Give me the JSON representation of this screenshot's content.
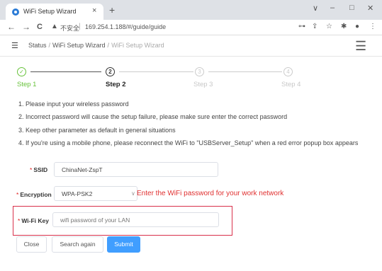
{
  "browser": {
    "tab_title": "WiFi Setup Wizard",
    "tab_close": "×",
    "new_tab": "+",
    "window_controls": [
      "∨",
      "–",
      "□",
      "✕"
    ],
    "nav": {
      "back": "←",
      "forward": "→",
      "reload": "C"
    },
    "security_label": "不安全",
    "url": "169.254.1.188/#/guide/guide"
  },
  "header": {
    "breadcrumbs": [
      "Status",
      "WiFi Setup Wizard",
      "WiFi Setup Wizard"
    ]
  },
  "steps": [
    {
      "label": "Step 1",
      "state": "done",
      "symbol": "✓"
    },
    {
      "label": "Step 2",
      "state": "current",
      "symbol": "2"
    },
    {
      "label": "Step 3",
      "state": "pending",
      "symbol": "3"
    },
    {
      "label": "Step 4",
      "state": "pending",
      "symbol": "4"
    }
  ],
  "instructions": [
    "1. Please input your wireless password",
    "2. Incorrect password will cause the setup failure, please make sure enter the correct password",
    "3. Keep other parameter as default in general situations",
    "4. If you're using a mobile phone, please reconnect the WiFi to \"USBServer_Setup\" when a red error popup box appears"
  ],
  "form": {
    "ssid": {
      "label": "SSID",
      "value": "ChinaNet-ZspT"
    },
    "encryption": {
      "label": "Encryption",
      "value": "WPA-PSK2"
    },
    "wifi_key": {
      "label": "Wi-Fi Key",
      "placeholder": "wifi password of your LAN"
    },
    "required_mark": "*"
  },
  "annotation": "Enter the WiFi password for your work network",
  "buttons": {
    "close": "Close",
    "search_again": "Search again",
    "submit": "Submit"
  },
  "colors": {
    "step_done": "#67c23a",
    "primary": "#409eff",
    "annotation": "#e03030",
    "highlight_border": "#d9304b"
  }
}
